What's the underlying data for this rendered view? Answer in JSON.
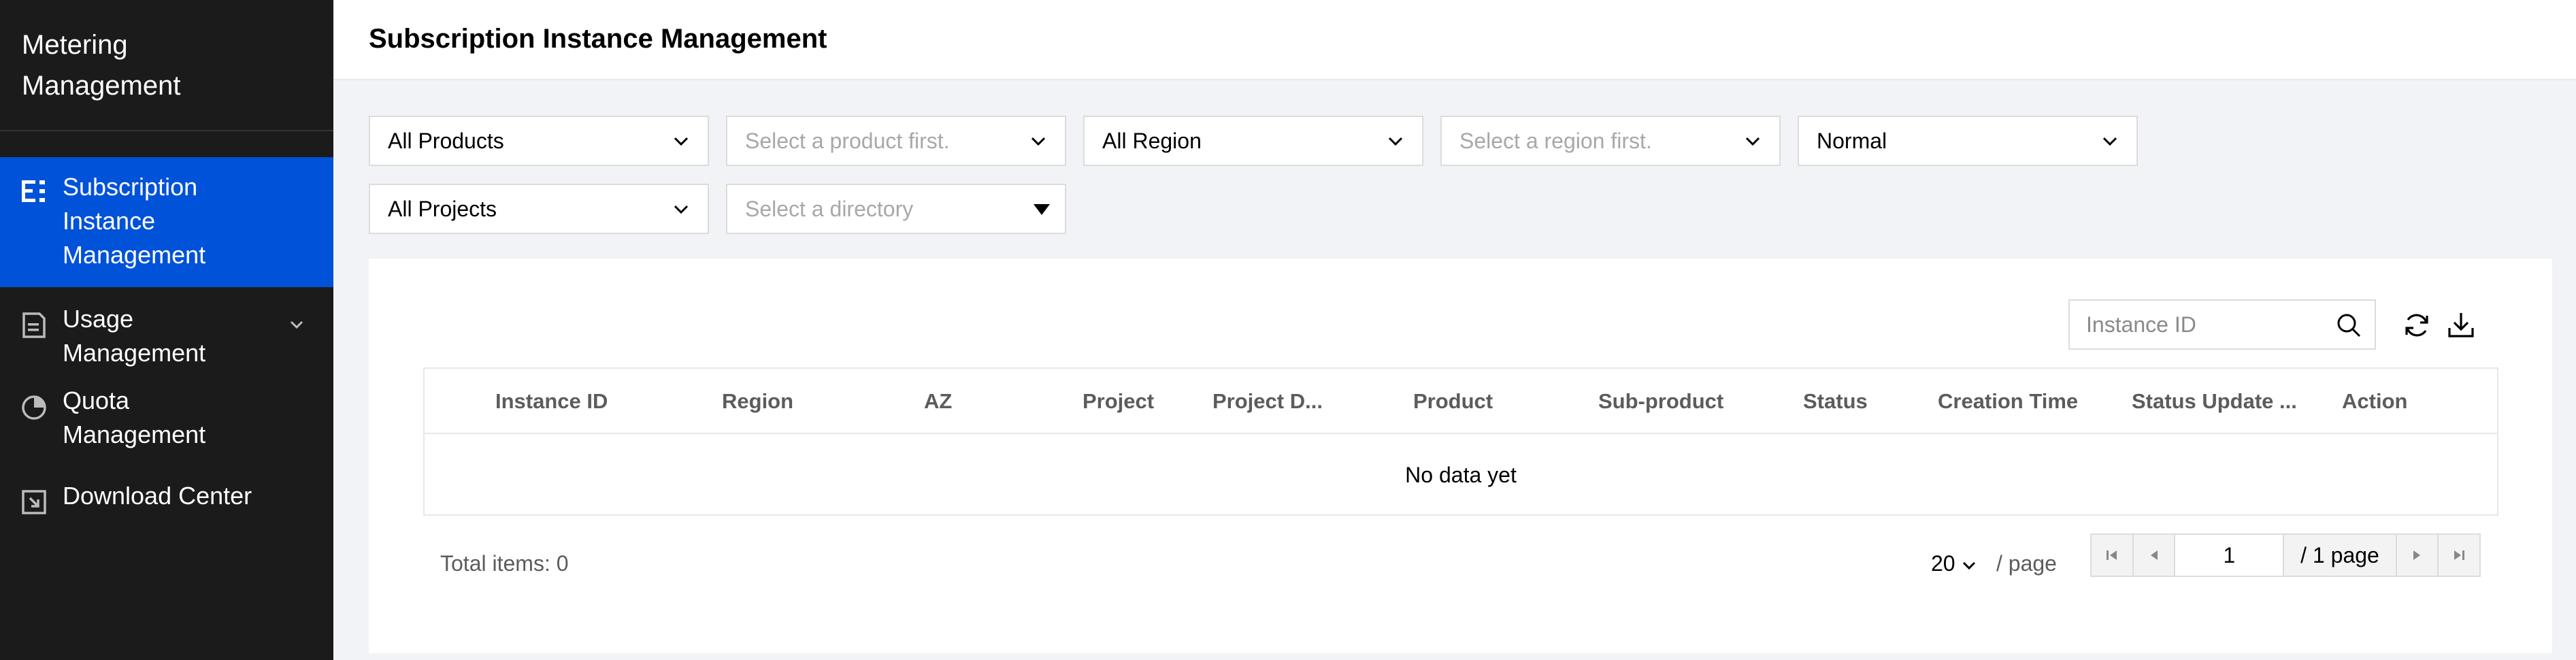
{
  "sidebar": {
    "brand_line1": "Metering",
    "brand_line2": "Management",
    "items": [
      {
        "label_lines": [
          "Subscription",
          "Instance",
          "Management"
        ],
        "icon": "list-icon",
        "active": true
      },
      {
        "label_lines": [
          "Usage",
          "Management"
        ],
        "icon": "document-icon",
        "expandable": true
      },
      {
        "label_lines": [
          "Quota",
          "Management"
        ],
        "icon": "pie-chart-icon"
      },
      {
        "label_lines": [
          "Download Center"
        ],
        "icon": "download-box-icon"
      }
    ]
  },
  "header": {
    "title": "Subscription Instance Management"
  },
  "filters": {
    "product": "All Products",
    "sub_product_placeholder": "Select a product first.",
    "region": "All Region",
    "az_placeholder": "Select a region first.",
    "status": "Normal",
    "project": "All Projects",
    "directory_placeholder": "Select a directory"
  },
  "toolbar": {
    "search_placeholder": "Instance ID",
    "icons": [
      "search-icon",
      "refresh-icon",
      "download-icon"
    ]
  },
  "table": {
    "columns": [
      "Instance ID",
      "Region",
      "AZ",
      "Project",
      "Project D...",
      "Product",
      "Sub-product",
      "Status",
      "Creation Time",
      "Status Update ...",
      "Action"
    ],
    "empty_text": "No data yet"
  },
  "pagination": {
    "total_label": "Total items: 0",
    "page_size": "20",
    "page_size_suffix": "/ page",
    "current_page": "1",
    "total_pages_label": "/ 1 page"
  },
  "colors": {
    "sidebar_bg": "#1b1b1b",
    "accent": "#0052d9",
    "page_bg": "#f2f3f7"
  }
}
